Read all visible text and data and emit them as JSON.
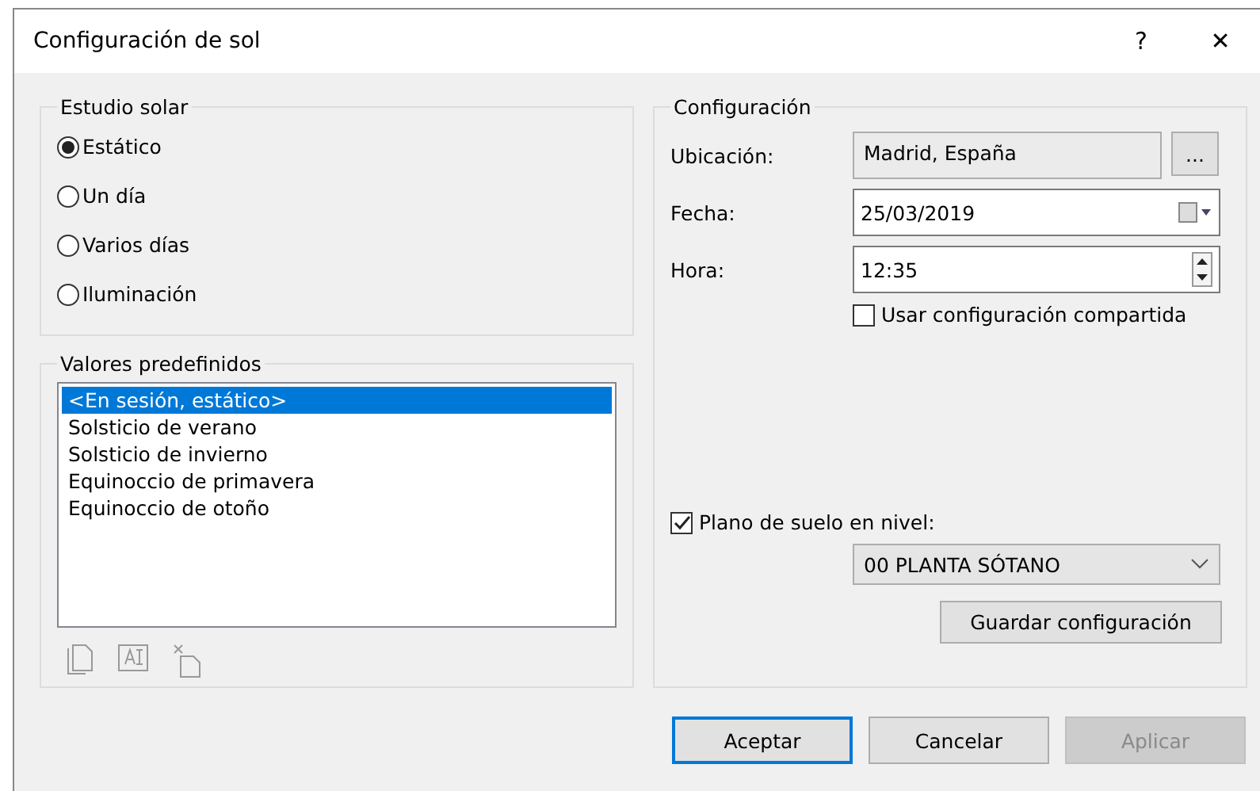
{
  "window": {
    "title": "Configuración de sol",
    "help": "?",
    "close": "✕"
  },
  "solar_study": {
    "title": "Estudio solar",
    "options": [
      {
        "label": "Estático",
        "selected": true
      },
      {
        "label": "Un día",
        "selected": false
      },
      {
        "label": "Varios días",
        "selected": false
      },
      {
        "label": "Iluminación",
        "selected": false
      }
    ]
  },
  "presets": {
    "title": "Valores predefinidos",
    "items": [
      {
        "label": "<En sesión, estático>",
        "selected": true
      },
      {
        "label": "Solsticio de verano",
        "selected": false
      },
      {
        "label": "Solsticio de invierno",
        "selected": false
      },
      {
        "label": "Equinoccio de primavera",
        "selected": false
      },
      {
        "label": "Equinoccio de otoño",
        "selected": false
      }
    ]
  },
  "settings": {
    "title": "Configuración",
    "location": {
      "label": "Ubicación:",
      "value": "Madrid, España",
      "browse": "..."
    },
    "date": {
      "label": "Fecha:",
      "value": "25/03/2019"
    },
    "time": {
      "label": "Hora:",
      "value": "12:35"
    },
    "shared": {
      "label": "Usar configuración compartida",
      "checked": false
    },
    "ground_plane": {
      "label": "Plano de suelo en nivel:",
      "checked": true,
      "level_value": "00 PLANTA SÓTANO"
    },
    "save": "Guardar configuración"
  },
  "buttons": [
    {
      "label": "Aceptar",
      "default": true,
      "disabled": false
    },
    {
      "label": "Cancelar",
      "default": false,
      "disabled": false
    },
    {
      "label": "Aplicar",
      "default": false,
      "disabled": true
    }
  ]
}
